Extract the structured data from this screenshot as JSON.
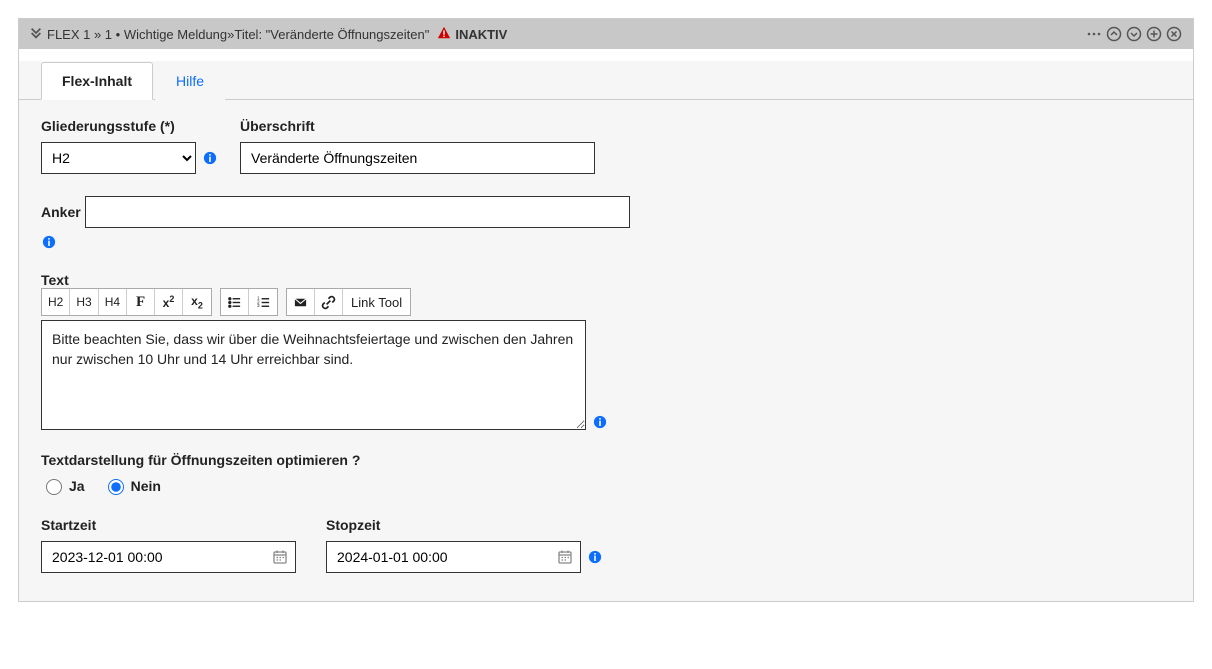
{
  "header": {
    "breadcrumb_prefix": "FLEX 1 »  1 • Wichtige Meldung»Titel: \"Veränderte Öffnungszeiten\"",
    "status_label": "INAKTIV"
  },
  "tabs": {
    "content": "Flex-Inhalt",
    "help": "Hilfe"
  },
  "form": {
    "gliederung_label": "Gliederungsstufe (*)",
    "gliederung_value": "H2",
    "ueberschrift_label": "Überschrift",
    "ueberschrift_value": "Veränderte Öffnungszeiten",
    "anker_label": "Anker",
    "anker_value": "",
    "text_label": "Text",
    "text_value": "Bitte beachten Sie, dass wir über die Weihnachtsfeiertage und zwischen den Jahren nur zwischen 10 Uhr und 14 Uhr erreichbar sind.",
    "toolbar": {
      "h2": "H2",
      "h3": "H3",
      "h4": "H4",
      "bold": "F",
      "sup": "x",
      "sub": "x",
      "link_tool": "Link Tool"
    },
    "optimize_label": "Textdarstellung für Öffnungszeiten optimieren ?",
    "optimize_yes": "Ja",
    "optimize_no": "Nein",
    "optimize_value": "Nein",
    "start_label": "Startzeit",
    "start_value": "2023-12-01 00:00",
    "stop_label": "Stopzeit",
    "stop_value": "2024-01-01 00:00"
  }
}
